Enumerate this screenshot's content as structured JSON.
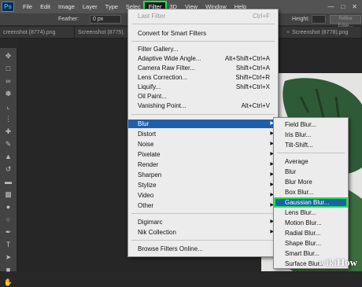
{
  "menubar": {
    "logo": "Ps",
    "items": [
      "File",
      "Edit",
      "Image",
      "Layer",
      "Type",
      "Selec",
      "Filter",
      "3D",
      "View",
      "Window",
      "Help"
    ],
    "active": "Filter"
  },
  "options_bar": {
    "feather_label": "Feather:",
    "feather_value": "0 px",
    "height_label": "Height:",
    "refine_label": "Refine Edge..."
  },
  "tabs": [
    "creenshot (8774).png",
    "Screenshot (8775).",
    "Screenshot (8778).png"
  ],
  "filter_menu": {
    "items": [
      {
        "label": "Last Filter",
        "shortcut": "Ctrl+F",
        "disabled": true
      },
      {
        "label": "Convert for Smart Filters"
      },
      {
        "label": "Filter Gallery..."
      },
      {
        "label": "Adaptive Wide Angle...",
        "shortcut": "Alt+Shift+Ctrl+A"
      },
      {
        "label": "Camera Raw Filter...",
        "shortcut": "Shift+Ctrl+A"
      },
      {
        "label": "Lens Correction...",
        "shortcut": "Shift+Ctrl+R"
      },
      {
        "label": "Liquify...",
        "shortcut": "Shift+Ctrl+X"
      },
      {
        "label": "Oil Paint..."
      },
      {
        "label": "Vanishing Point...",
        "shortcut": "Alt+Ctrl+V"
      },
      {
        "label": "Blur",
        "submenu": true,
        "highlighted": true
      },
      {
        "label": "Distort",
        "submenu": true
      },
      {
        "label": "Noise",
        "submenu": true
      },
      {
        "label": "Pixelate",
        "submenu": true
      },
      {
        "label": "Render",
        "submenu": true
      },
      {
        "label": "Sharpen",
        "submenu": true
      },
      {
        "label": "Stylize",
        "submenu": true
      },
      {
        "label": "Video",
        "submenu": true
      },
      {
        "label": "Other",
        "submenu": true
      },
      {
        "label": "Digimarc",
        "submenu": true
      },
      {
        "label": "Nik Collection",
        "submenu": true
      },
      {
        "label": "Browse Filters Online..."
      }
    ]
  },
  "blur_submenu": {
    "items": [
      "Field Blur...",
      "Iris Blur...",
      "Tilt-Shift...",
      "Average",
      "Blur",
      "Blur More",
      "Box Blur...",
      "Gaussian Blur...",
      "Lens Blur...",
      "Motion Blur...",
      "Radial Blur...",
      "Shape Blur...",
      "Smart Blur...",
      "Surface Blur..."
    ],
    "selected": "Gaussian Blur..."
  },
  "watermark": {
    "part1": "wiki",
    "part2": "How"
  },
  "colors": {
    "highlight": "#1f5faa",
    "callout": "#16e64a"
  }
}
